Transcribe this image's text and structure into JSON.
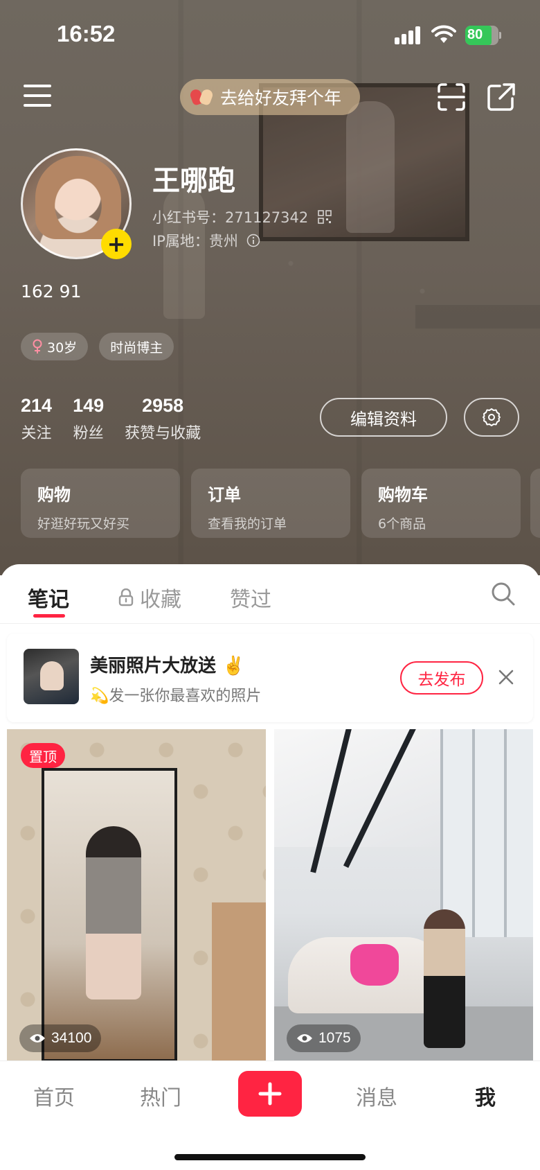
{
  "status_bar": {
    "time": "16:52",
    "battery": "80"
  },
  "header": {
    "greeting_pill": "去给好友拜个年"
  },
  "profile": {
    "nickname": "王哪跑",
    "user_id": "小红书号：271127342",
    "ip_location": "IP属地：贵州",
    "bio": "162 91",
    "tags": [
      "30岁",
      "时尚博主"
    ]
  },
  "stats": [
    {
      "value": "214",
      "label": "关注"
    },
    {
      "value": "149",
      "label": "粉丝"
    },
    {
      "value": "2958",
      "label": "获赞与收藏"
    }
  ],
  "buttons": {
    "edit_profile": "编辑资料"
  },
  "service_cards": [
    {
      "title": "购物",
      "subtitle": "好逛好玩又好买"
    },
    {
      "title": "订单",
      "subtitle": "查看我的订单"
    },
    {
      "title": "购物车",
      "subtitle": "6个商品"
    }
  ],
  "tabs": [
    {
      "label": "笔记",
      "active": true
    },
    {
      "label": "收藏",
      "locked": true
    },
    {
      "label": "赞过"
    }
  ],
  "promo": {
    "title": "美丽照片大放送 ✌️",
    "subtitle": "💫发一张你最喜欢的照片",
    "button": "去发布"
  },
  "notes": [
    {
      "pinned_label": "置顶",
      "views": "34100"
    },
    {
      "views": "1075"
    }
  ],
  "bottom_nav": [
    {
      "label": "首页"
    },
    {
      "label": "热门"
    },
    {
      "label": "消息"
    },
    {
      "label": "我",
      "active": true
    }
  ],
  "colors": {
    "accent": "#ff2442",
    "avatar_plus": "#ffdc00",
    "battery": "#35c759"
  }
}
